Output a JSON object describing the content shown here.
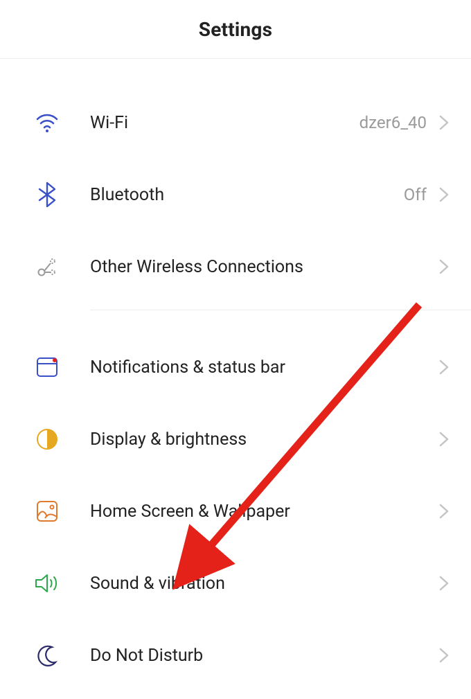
{
  "header": {
    "title": "Settings"
  },
  "items": [
    {
      "id": "wifi",
      "icon": "wifi-icon",
      "label": "Wi-Fi",
      "value": "dzer6_40"
    },
    {
      "id": "bluetooth",
      "icon": "bluetooth-icon",
      "label": "Bluetooth",
      "value": "Off"
    },
    {
      "id": "other-wireless",
      "icon": "share-icon",
      "label": "Other Wireless Connections",
      "value": ""
    },
    {
      "id": "notifications",
      "icon": "notification-panel-icon",
      "label": "Notifications & status bar",
      "value": ""
    },
    {
      "id": "display",
      "icon": "half-circle-icon",
      "label": "Display & brightness",
      "value": ""
    },
    {
      "id": "homescreen",
      "icon": "wallpaper-icon",
      "label": "Home Screen & Wallpaper",
      "value": ""
    },
    {
      "id": "sound",
      "icon": "sound-icon",
      "label": "Sound & vibration",
      "value": ""
    },
    {
      "id": "dnd",
      "icon": "moon-icon",
      "label": "Do Not Disturb",
      "value": ""
    }
  ],
  "annotation": {
    "arrow_color": "#e5221a"
  }
}
